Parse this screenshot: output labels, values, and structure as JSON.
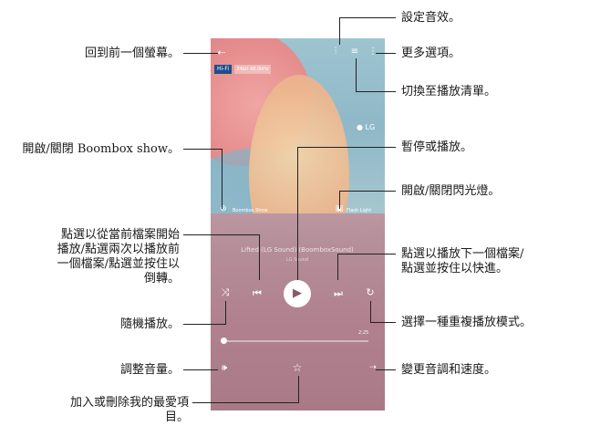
{
  "callouts": {
    "back": "回到前一個螢幕。",
    "boombox": "開啟/關閉 Boombox show。",
    "rewind_1": "點選以從當前檔案開始",
    "rewind_2": "播放/點選兩次以播放前",
    "rewind_3": "一個檔案/點選並按住以",
    "rewind_4": "倒轉。",
    "shuffle": "隨機播放。",
    "volume": "調整音量。",
    "favorite_1": "加入或刪除我的最愛項",
    "favorite_2": "目。",
    "sound_effects": "設定音效。",
    "more_options": "更多選項。",
    "playlist": "切換至播放清單。",
    "pause_play": "暫停或播放。",
    "flash": "開啟/關閉閃光燈。",
    "next_1": "點選以播放下一個檔案/",
    "next_2": "點選並按住以快進。",
    "repeat": "選擇一種重複播放模式。",
    "pitch_speed": "變更音調和速度。"
  },
  "player": {
    "hifi_badge": "Hi-Fi",
    "hifi_detail": "24bit 48.0kHz",
    "lg_logo": "LG",
    "boombox_label": "Boombox Show",
    "flash_label": "Flash Light",
    "song_title": "Lifted (LG Sound) (BoomboxSound)",
    "artist": "LG Sound",
    "progress_fraction": 0.02,
    "time_total": "2:25"
  },
  "icons": {
    "back": "back-arrow-icon",
    "equalizer": "equalizer-icon",
    "playlist": "playlist-icon",
    "more": "more-vert-icon",
    "boombox": "boombox-icon",
    "flash": "flash-icon",
    "previous": "previous-icon",
    "play": "play-icon",
    "next": "next-icon",
    "shuffle": "shuffle-icon",
    "repeat": "repeat-icon",
    "volume": "volume-icon",
    "favorite": "star-icon",
    "pitch": "pitch-icon"
  }
}
